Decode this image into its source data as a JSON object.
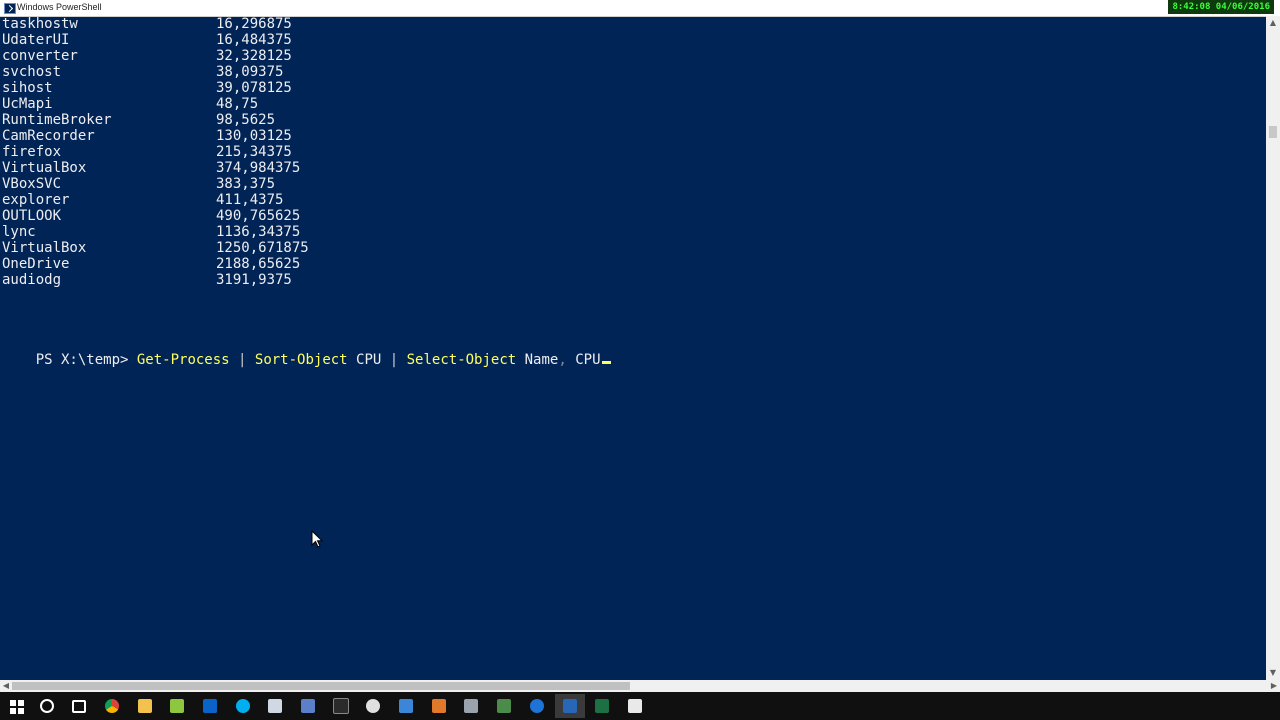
{
  "window": {
    "title": "Windows PowerShell",
    "clock": "8:42:08  04/06/2016"
  },
  "console": {
    "rows": [
      {
        "name": "taskhostw",
        "cpu": "16,296875"
      },
      {
        "name": "UdaterUI",
        "cpu": "16,484375"
      },
      {
        "name": "converter",
        "cpu": "32,328125"
      },
      {
        "name": "svchost",
        "cpu": "38,09375"
      },
      {
        "name": "sihost",
        "cpu": "39,078125"
      },
      {
        "name": "UcMapi",
        "cpu": "48,75"
      },
      {
        "name": "RuntimeBroker",
        "cpu": "98,5625"
      },
      {
        "name": "CamRecorder",
        "cpu": "130,03125"
      },
      {
        "name": "firefox",
        "cpu": "215,34375"
      },
      {
        "name": "VirtualBox",
        "cpu": "374,984375"
      },
      {
        "name": "VBoxSVC",
        "cpu": "383,375"
      },
      {
        "name": "explorer",
        "cpu": "411,4375"
      },
      {
        "name": "OUTLOOK",
        "cpu": "490,765625"
      },
      {
        "name": "lync",
        "cpu": "1136,34375"
      },
      {
        "name": "VirtualBox",
        "cpu": "1250,671875"
      },
      {
        "name": "OneDrive",
        "cpu": "2188,65625"
      },
      {
        "name": "audiodg",
        "cpu": "3191,9375"
      }
    ],
    "prompt": {
      "ps": "PS X:\\temp> ",
      "cmd1": "Get-Process",
      "pipe1": " | ",
      "cmd2": "Sort-Object",
      "arg2": " CPU",
      "pipe2": " | ",
      "cmd3": "Select-Object",
      "arg3a": " Name",
      "sep": ",",
      "arg3b": " CPU"
    }
  },
  "colors": {
    "console_bg": "#012456",
    "console_fg": "#eeedf0",
    "cmdlet": "#ffff60"
  },
  "taskbar": {
    "icons": [
      "windows-start-icon",
      "search-icon",
      "task-view-icon",
      "chrome-icon",
      "file-explorer-icon",
      "notepadpp-icon",
      "outlook-icon",
      "skype-icon",
      "virtualbox-icon",
      "vbox-app-icon",
      "terminal-icon",
      "settings-icon",
      "remote-desktop-icon",
      "paint-icon",
      "wrench-icon",
      "cmd-app-icon",
      "edge-icon",
      "powershell-icon",
      "excel-icon",
      "camtasia-icon"
    ],
    "active_icon": "powershell-icon"
  }
}
